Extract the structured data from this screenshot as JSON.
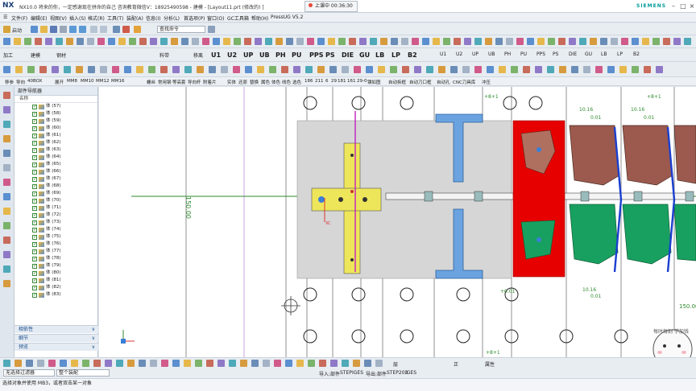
{
  "titlebar": {
    "app": "NX",
    "title": "NX10.0 将来的你，一定感谢现在拼命的自己 咨询教育微信V：18925490598 - 建模 - [Layout11.prt  (修改的)  ]",
    "recording": "上课中 00:36:30",
    "brand": "SIEMENS"
  },
  "menu": [
    "文件(F)",
    "编辑(E)",
    "视图(V)",
    "插入(S)",
    "格式(R)",
    "工具(T)",
    "装配(A)",
    "信息(I)",
    "分析(L)",
    "首选项(P)",
    "窗口(O)",
    "GC工具箱",
    "帮助(H)",
    "PressUG V5.2"
  ],
  "toolbar1": {
    "start": "启动",
    "search_placeholder": "查找命令"
  },
  "toolbar3": {
    "labels": [
      "加工",
      "建模",
      "钢材",
      "导出",
      "料带",
      "冲裁",
      "分析",
      "移离",
      "标注",
      "分框",
      "U1",
      "U2",
      "UP",
      "UB",
      "PH",
      "PU",
      "PPS",
      "PS",
      "DIE",
      "GU",
      "LB",
      "LP",
      "B2",
      "U1",
      "U2",
      "UP",
      "UB",
      "PH",
      "PU",
      "PPS",
      "PS",
      "DIE",
      "GU",
      "LB",
      "LP",
      "B2"
    ]
  },
  "toolbar4": {
    "labels": [
      "移参",
      "导向",
      "40BOX",
      "展开",
      "MM8",
      "MM10",
      "MM12",
      "MM16",
      "螺丝",
      "常用钢",
      "等高套",
      "导向杆",
      "附着片",
      "实体",
      "还原",
      "替换",
      "属色",
      "体色",
      "线色",
      "选色",
      "186",
      "211",
      "6",
      "29",
      "181",
      "161",
      "29-0",
      "镶如图",
      "自动拆框",
      "自动刀口框",
      "自动孔",
      "CNC刀具库",
      "查",
      "开",
      "M4"
    ]
  },
  "cmdbar": [
    "移参",
    "导向",
    "40BOX",
    "展开",
    "MM8",
    "MM10",
    "MM12",
    "MM16",
    "螺丝",
    "常用钢",
    "等高套",
    "导向杆",
    "附着片",
    "实体",
    "还原",
    "替换",
    "属色",
    "体色",
    "线色",
    "选色",
    "186",
    "211",
    "6",
    "29",
    "181",
    "161",
    "29-0",
    "镶如图",
    "自动拆框",
    "自动刀口框",
    "自动孔",
    "CNC刀具库",
    "冲压"
  ],
  "navigator": {
    "title": "部件导航器",
    "column": "名称",
    "items": [
      "体 (57)",
      "体 (58)",
      "体 (59)",
      "体 (60)",
      "体 (61)",
      "体 (62)",
      "体 (63)",
      "体 (64)",
      "体 (65)",
      "体 (66)",
      "体 (67)",
      "体 (68)",
      "体 (69)",
      "体 (70)",
      "体 (71)",
      "体 (72)",
      "体 (73)",
      "体 (74)",
      "体 (75)",
      "体 (76)",
      "体 (77)",
      "体 (78)",
      "体 (79)",
      "体 (80)",
      "体 (81)",
      "体 (82)",
      "体 (83)"
    ],
    "sections": [
      "相依性",
      "细节",
      "预览"
    ]
  },
  "viewport": {
    "dim_left": "150.00",
    "dim_top1": "+8+1",
    "dim_top2": "+8+1",
    "labels_right": [
      "10.16",
      "0.01",
      "10.16",
      "0.01",
      "150.00",
      "10.16",
      "0.01"
    ],
    "bottom_label": "+0.01",
    "dim_bottom": "+8+1",
    "view_label": "XC",
    "wm": "每时每刻 学加钱"
  },
  "bottombar": {
    "labels": [
      "层",
      "正",
      "属性",
      "导入:部件",
      "STEP",
      "IGES",
      "导出:部件",
      "STEP203",
      "IGES"
    ]
  },
  "selbar": {
    "filter": "无选择过滤器",
    "scope": "整个装配"
  },
  "status": {
    "text": "选择对象并使用 MB3，或者双击某一对象"
  },
  "colors": {
    "red": "#e60000",
    "green": "#18a060",
    "yellow": "#f0ea40",
    "blue": "#3a7fd6",
    "brown": "#9c5a4e",
    "plate": "#cfcfcf"
  }
}
